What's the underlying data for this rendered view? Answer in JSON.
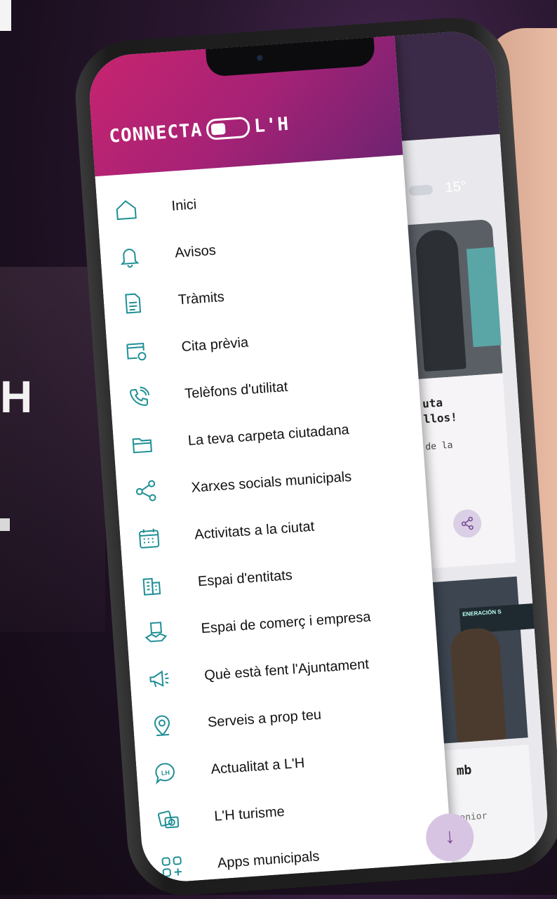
{
  "background": {
    "letter": "H",
    "accent": "#2a1730"
  },
  "app": {
    "logo_left": "CONNECTA",
    "logo_right": "L'H",
    "brand_gradient": [
      "#c7246f",
      "#6f2371"
    ],
    "icon_color": "#1f8f96"
  },
  "menu": {
    "items": [
      {
        "label": "Inici",
        "icon": "home-icon"
      },
      {
        "label": "Avisos",
        "icon": "bell-icon"
      },
      {
        "label": "Tràmits",
        "icon": "document-icon"
      },
      {
        "label": "Cita prèvia",
        "icon": "calendar-clock-icon"
      },
      {
        "label": "Telèfons d'utilitat",
        "icon": "phone-icon"
      },
      {
        "label": "La teva carpeta ciutadana",
        "icon": "folder-icon"
      },
      {
        "label": "Xarxes socials municipals",
        "icon": "share-icon"
      },
      {
        "label": "Activitats a la ciutat",
        "icon": "calendar-icon"
      },
      {
        "label": "Espai d'entitats",
        "icon": "buildings-icon"
      },
      {
        "label": "Espai de comerç i empresa",
        "icon": "handshake-building-icon"
      },
      {
        "label": "Què està fent l'Ajuntament",
        "icon": "megaphone-icon"
      },
      {
        "label": "Serveis a prop teu",
        "icon": "location-pin-icon"
      },
      {
        "label": "Actualitat a L'H",
        "icon": "chat-bubble-icon"
      },
      {
        "label": "L'H turisme",
        "icon": "camera-photos-icon"
      },
      {
        "label": "Apps municipals",
        "icon": "apps-grid-icon"
      }
    ]
  },
  "behind": {
    "temperature": "15°",
    "card1_title_1": "uta",
    "card1_title_2": "llos!",
    "card1_text": "de la",
    "banner_text": "ENERACIÓN S",
    "card2_title": "mb",
    "card2_text": "enior"
  },
  "fab": {
    "icon": "arrow-down-icon",
    "symbol": "↓"
  }
}
